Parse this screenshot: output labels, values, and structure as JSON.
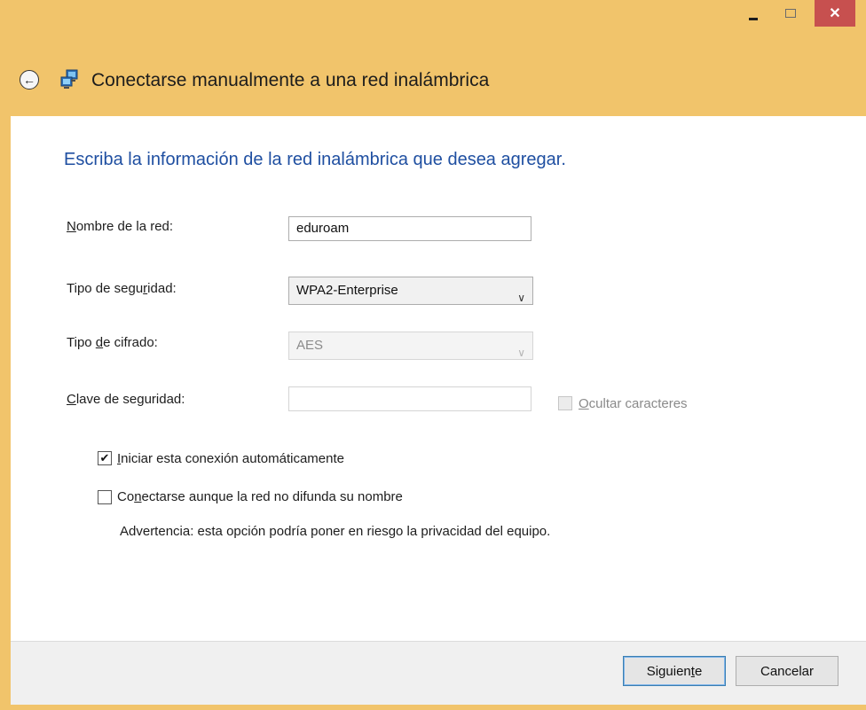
{
  "window": {
    "close_glyph": "✕"
  },
  "header": {
    "back_icon": "back-arrow-icon",
    "network_icon": "network-icon",
    "title": "Conectarse manualmente a una red inalámbrica"
  },
  "form": {
    "instruction": "Escriba la información de la red inalámbrica que desea agregar.",
    "network_name": {
      "label_pre": "",
      "label_key": "N",
      "label_post": "ombre de la red:",
      "value": "eduroam"
    },
    "security_type": {
      "label_pre": "Tipo de segu",
      "label_key": "r",
      "label_post": "idad:",
      "value": "WPA2-Enterprise"
    },
    "encryption_type": {
      "label_pre": "Tipo ",
      "label_key": "d",
      "label_post": "e cifrado:",
      "value": "AES"
    },
    "security_key": {
      "label_pre": "",
      "label_key": "C",
      "label_post": "lave de seguridad:",
      "value": ""
    },
    "hide_chars": {
      "label_pre": "",
      "label_key": "O",
      "label_post": "cultar caracteres",
      "checked": false
    },
    "auto_connect": {
      "label_pre": "",
      "label_key": "I",
      "label_post": "niciar esta conexión automáticamente",
      "checked": true
    },
    "hidden_network": {
      "label_pre": "Co",
      "label_key": "n",
      "label_post": "ectarse aunque la red no difunda su nombre",
      "checked": false
    },
    "warning": "Advertencia: esta opción podría poner en riesgo la privacidad del equipo."
  },
  "footer": {
    "next": {
      "label_pre": "Siguien",
      "label_key": "t",
      "label_post": "e"
    },
    "cancel": "Cancelar"
  },
  "colors": {
    "titlebar": "#f1c46b",
    "instruction": "#1f4fa1",
    "close": "#c7504f"
  }
}
